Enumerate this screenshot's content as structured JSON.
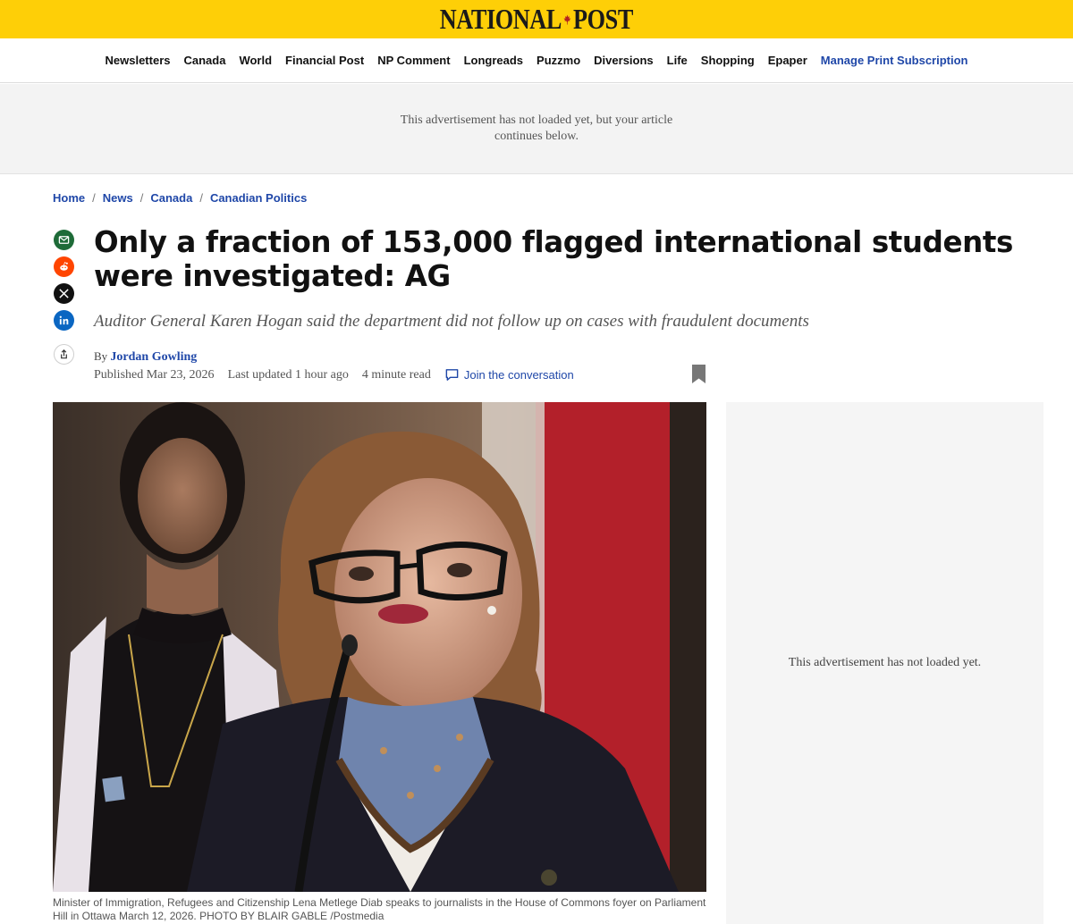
{
  "header": {
    "logo_left": "NATIONAL",
    "logo_right": "POST",
    "logo_icon": "maple-leaf-icon",
    "brand_color": "#fecf07"
  },
  "nav": {
    "items": [
      "Newsletters",
      "Canada",
      "World",
      "Financial Post",
      "NP Comment",
      "Longreads",
      "Puzzmo",
      "Diversions",
      "Life",
      "Shopping",
      "Epaper"
    ],
    "subscribe_label": "Manage Print Subscription",
    "link_color": "#1f47a8"
  },
  "ad_top": {
    "text": "This advertisement has not loaded yet, but your article continues below."
  },
  "breadcrumb": {
    "items": [
      "Home",
      "News",
      "Canada",
      "Canadian Politics"
    ],
    "separator": "/"
  },
  "share": {
    "icons": [
      "email-icon",
      "reddit-icon",
      "x-icon",
      "linkedin-icon",
      "share-icon"
    ]
  },
  "article": {
    "headline": "Only a fraction of 153,000 flagged international students were investigated: AG",
    "dek": "Auditor General Karen Hogan said the department did not follow up on cases with fraudulent documents",
    "byline_prefix": "By",
    "author": "Jordan Gowling",
    "published": "Published Mar 23, 2026",
    "updated": "Last updated 1 hour ago",
    "read_time": "4 minute read",
    "conversation_label": "Join the conversation",
    "caption": "Minister of Immigration, Refugees and Citizenship Lena Metlege Diab speaks to journalists in the House of Commons foyer on Parliament Hill in Ottawa March 12, 2026. PHOTO BY BLAIR GABLE /Postmedia"
  },
  "ad_side": {
    "text": "This advertisement has not loaded yet."
  }
}
